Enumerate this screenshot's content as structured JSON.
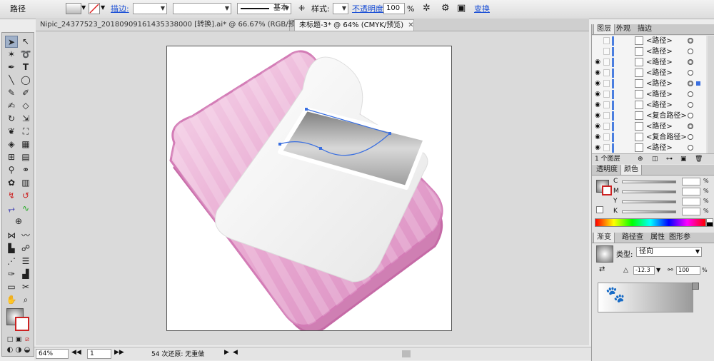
{
  "control_bar": {
    "object_type": "路径",
    "stroke_label": "描边:",
    "stroke_profile": "基本",
    "style_label": "样式:",
    "opacity_label": "不透明度:",
    "opacity_value": "100",
    "opacity_unit": "%",
    "transform_label": "变换"
  },
  "tabs": [
    {
      "label": "Nipic_24377523_20180909161435338000  [转换].ai* @ 66.67% (RGB/预览)",
      "active": false
    },
    {
      "label": "未标题-3* @ 64% (CMYK/预览)",
      "active": true
    }
  ],
  "status_bar": {
    "zoom": "64%",
    "page": "1",
    "undo_text": "54 次还原: 无重做"
  },
  "layers_panel": {
    "tabs": [
      "图层",
      "外观",
      "描边"
    ],
    "rows": [
      {
        "name": "<路径>",
        "visible": false,
        "target": "filled"
      },
      {
        "name": "<路径>",
        "visible": false,
        "target": "empty"
      },
      {
        "name": "<路径>",
        "visible": true,
        "target": "filled"
      },
      {
        "name": "<路径>",
        "visible": true,
        "target": "empty"
      },
      {
        "name": "<路径>",
        "visible": true,
        "target": "selected"
      },
      {
        "name": "<路径>",
        "visible": true,
        "target": "empty"
      },
      {
        "name": "<路径>",
        "visible": true,
        "target": "empty"
      },
      {
        "name": "<复合路径>",
        "visible": true,
        "target": "empty"
      },
      {
        "name": "<路径>",
        "visible": true,
        "target": "filled"
      },
      {
        "name": "<复合路径>",
        "visible": true,
        "target": "empty"
      },
      {
        "name": "<路径>",
        "visible": true,
        "target": "empty"
      }
    ],
    "footer": "1 个图层"
  },
  "color_panel": {
    "tabs": [
      "透明度",
      "颜色"
    ],
    "channels": [
      "C",
      "M",
      "Y",
      "K"
    ],
    "unit": "%"
  },
  "gradient_panel": {
    "tabs": [
      "渐变",
      "路径查",
      "属性",
      "图形参"
    ],
    "type_label": "类型:",
    "type_value": "径向",
    "angle_value": "-12.3",
    "ratio_value": "100",
    "ratio_unit": "%"
  },
  "colors": {
    "folder_pink": "#d88ec0",
    "folder_light": "#f2c8e2",
    "paper": "#f0f0f0",
    "selection_blue": "#3a6fe0",
    "link_blue": "#1a4fd6"
  }
}
